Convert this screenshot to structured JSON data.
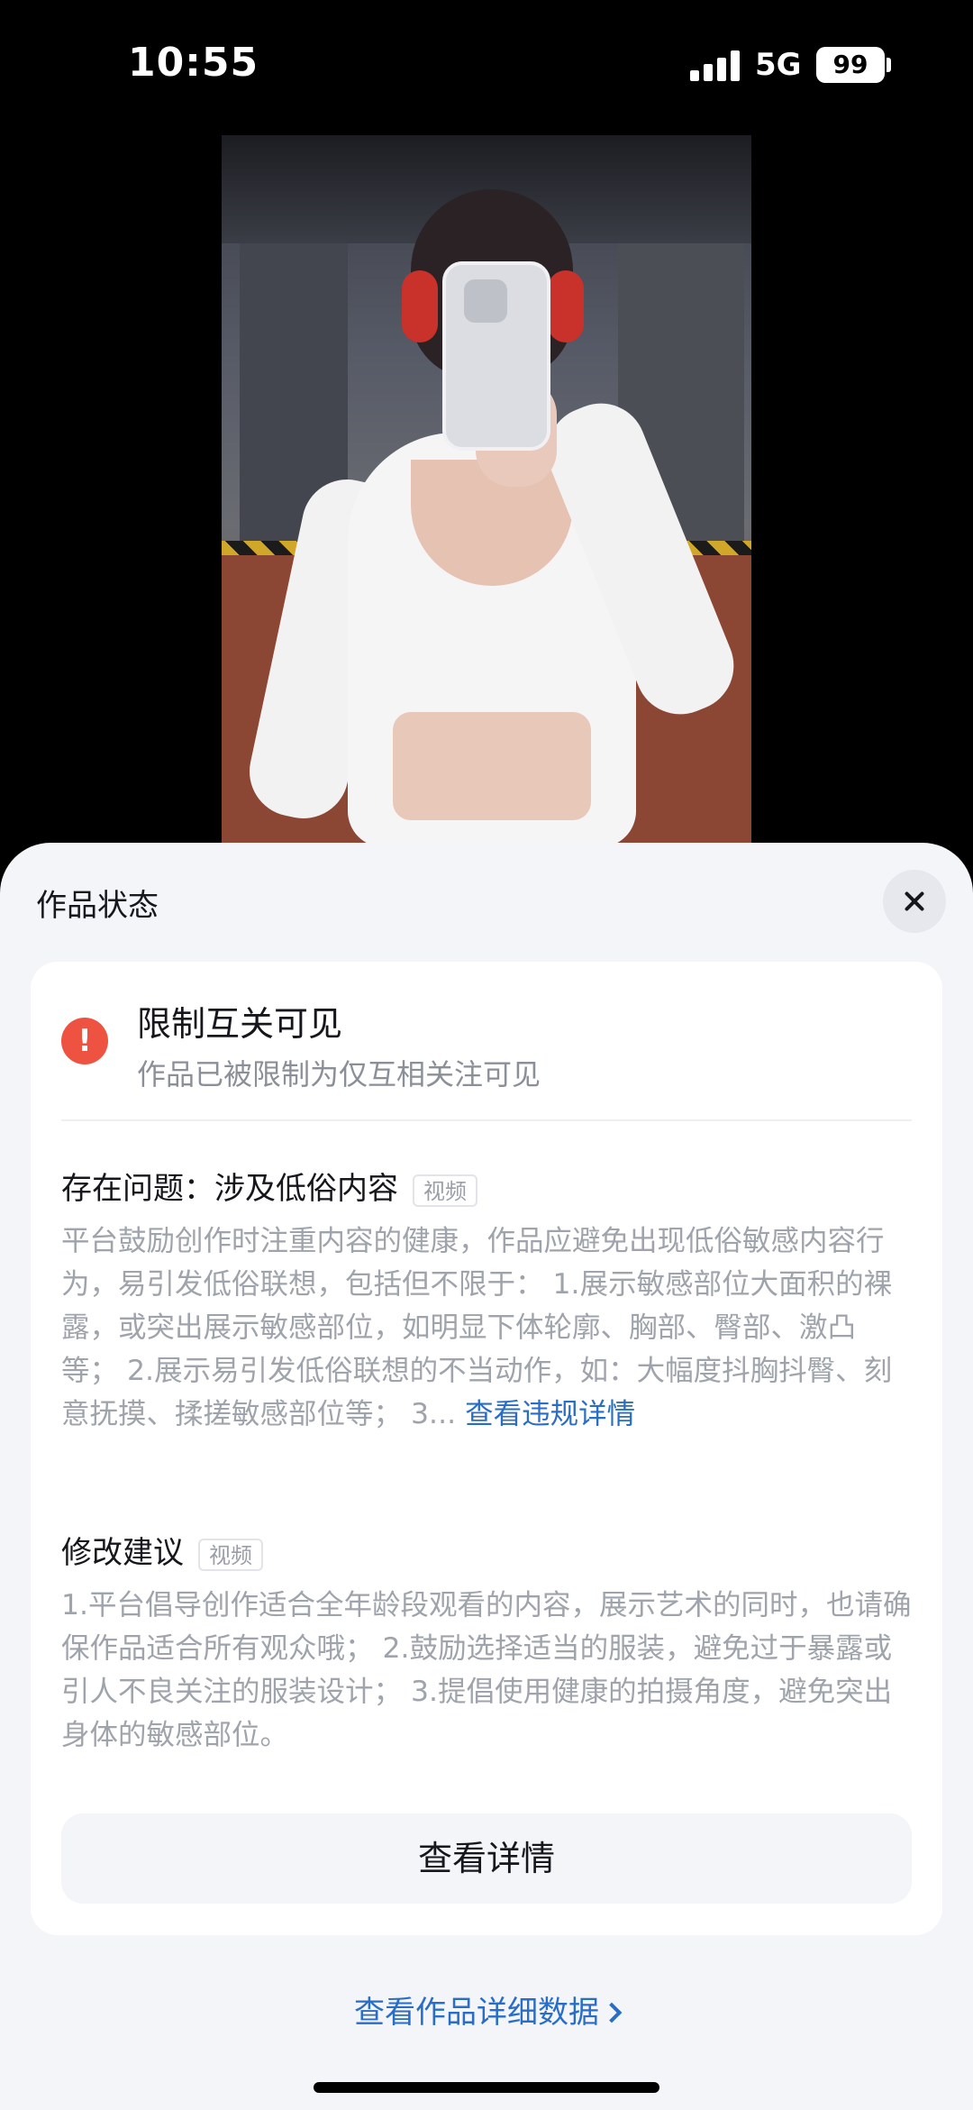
{
  "status_bar": {
    "time": "10:55",
    "network": "5G",
    "battery": "99"
  },
  "sheet": {
    "title": "作品状态",
    "status": {
      "icon": "alert-icon",
      "icon_glyph": "!",
      "title": "限制互关可见",
      "description": "作品已被限制为仅互相关注可见"
    },
    "issue": {
      "title": "存在问题：涉及低俗内容",
      "tag": "视频",
      "text": "平台鼓励创作时注重内容的健康，作品应避免出现低俗敏感内容行为，易引发低俗联想，包括但不限于： 1.展示敏感部位大面积的裸露，或突出展示敏感部位，如明显下体轮廓、胸部、臀部、激凸等； 2.展示易引发低俗联想的不当动作，如：大幅度抖胸抖臀、刻意抚摸、揉搓敏感部位等； 3...",
      "link": "查看违规详情"
    },
    "suggestion": {
      "title": "修改建议",
      "tag": "视频",
      "text": "1.平台倡导创作适合全年龄段观看的内容，展示艺术的同时，也请确保作品适合所有观众哦； 2.鼓励选择适当的服装，避免过于暴露或引人不良关注的服装设计； 3.提倡使用健康的拍摄角度，避免突出身体的敏感部位。"
    },
    "detail_button": "查看详情",
    "data_link": "查看作品详细数据"
  },
  "colors": {
    "accent": "#2a6dc6",
    "alert": "#ee5341",
    "sheet_bg": "#f4f5f9"
  }
}
